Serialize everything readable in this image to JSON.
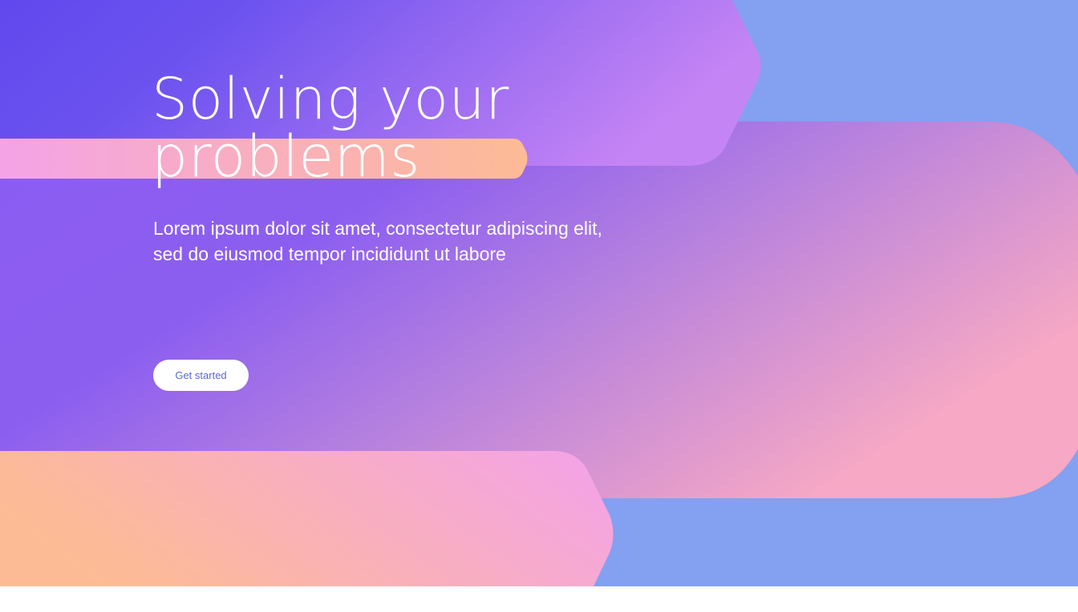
{
  "hero": {
    "title_line_1": "Solving your",
    "title_line_2": "problems",
    "subtitle": "Lorem ipsum dolor sit amet, consectetur adipiscing elit, sed do eiusmod tempor incididunt ut labore",
    "cta_label": "Get started"
  },
  "colors": {
    "background_blue": "#84a0f1",
    "indigo": "#6048ee",
    "violet": "#8b5cf1",
    "lilac": "#c584f4",
    "pink": "#f4a3e6",
    "peach": "#fdbb95",
    "button_text": "#5b67d8",
    "white": "#ffffff"
  }
}
